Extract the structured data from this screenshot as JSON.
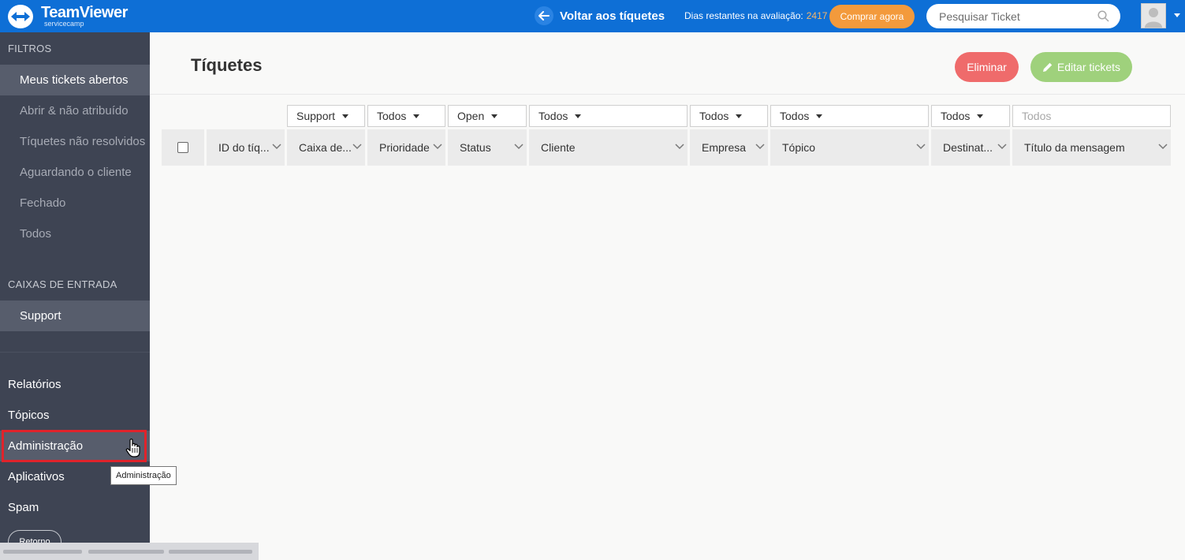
{
  "header": {
    "brand_name": "TeamViewer",
    "brand_sub": "servicecamp",
    "back_label": "Voltar aos tíquetes",
    "trial_label": "Dias restantes na avaliação:",
    "trial_days": "2417",
    "buy_label": "Comprar agora",
    "search_placeholder": "Pesquisar Ticket",
    "colors": {
      "bar": "#0e6fd6",
      "buy": "#f39a3c"
    }
  },
  "sidebar": {
    "filters_title": "FILTROS",
    "filters": [
      {
        "label": "Meus tickets abertos",
        "active": true
      },
      {
        "label": "Abrir & não atribuído"
      },
      {
        "label": "Tíquetes não resolvidos"
      },
      {
        "label": "Aguardando o cliente"
      },
      {
        "label": "Fechado"
      },
      {
        "label": "Todos"
      }
    ],
    "inboxes_title": "CAIXAS DE ENTRADA",
    "inboxes": [
      {
        "label": "Support",
        "active": true
      }
    ],
    "main_nav": [
      {
        "label": "Relatórios"
      },
      {
        "label": "Tópicos"
      },
      {
        "label": "Administração",
        "hover": true
      },
      {
        "label": "Aplicativos"
      },
      {
        "label": "Spam"
      }
    ],
    "return_label": "Retorno",
    "tooltip": "Administração"
  },
  "content": {
    "title": "Tíquetes",
    "delete_label": "Eliminar",
    "edit_label": "Editar tickets",
    "filters": [
      "Support",
      "Todos",
      "Open",
      "Todos",
      "Todos",
      "Todos",
      "Todos"
    ],
    "message_filter_placeholder": "Todos",
    "columns": [
      "ID do tíq...",
      "Caixa de...",
      "Prioridade",
      "Status",
      "Cliente",
      "Empresa",
      "Tópico",
      "Destinat...",
      "Título da mensagem"
    ],
    "colors": {
      "delete": "#ef6b6b",
      "edit": "#9fd17c"
    }
  }
}
